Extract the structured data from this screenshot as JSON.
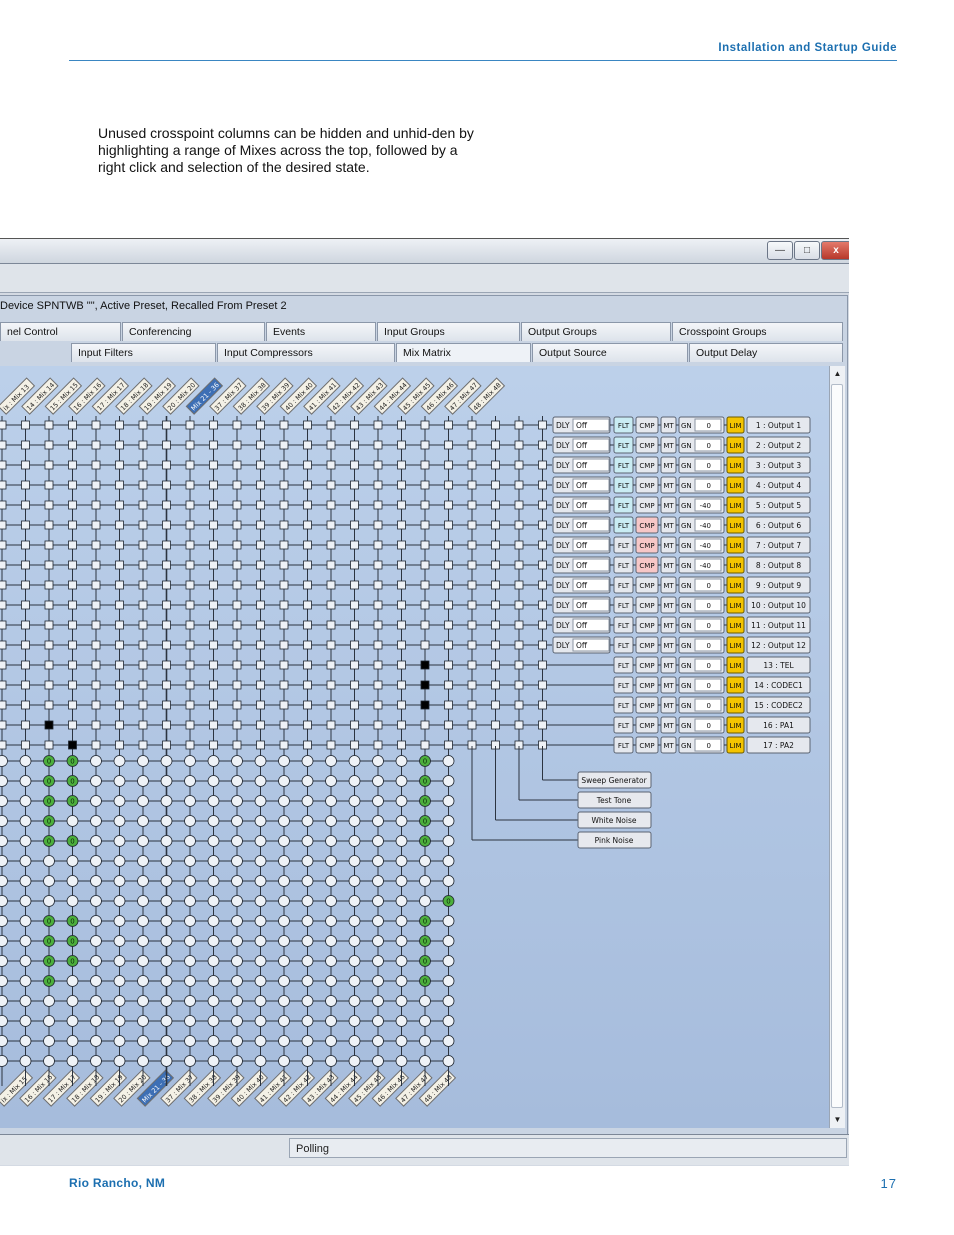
{
  "header": {
    "title": "Installation and Startup Guide"
  },
  "intro_text": "Unused crosspoint columns can be hidden and unhid-den by highlighting a range of Mixes across the top, followed by a right click and selection of the desired state.",
  "window": {
    "controls": {
      "minimize": "—",
      "maximize": "□",
      "close": "x"
    },
    "device_status": "Device SPNTWB \"\", Active Preset, Recalled From Preset 2",
    "tabs_row1": [
      "nel Control",
      "Conferencing",
      "Events",
      "Input Groups",
      "Output Groups",
      "Crosspoint Groups"
    ],
    "tabs_row2": [
      "Input Filters",
      "Input Compressors",
      "Mix Matrix",
      "Output Source",
      "Output Delay"
    ],
    "status_cell": "Polling"
  },
  "matrix": {
    "column_headers_top": [
      "ix : Mix 13",
      "14 : Mix 14",
      "15 : Mix 15",
      "16 : Mix 16",
      "17 : Mix 17",
      "18 : Mix 18",
      "19 : Mix 19",
      "20 : Mix 20",
      "Mix 21 - 36",
      "37 : Mix 37",
      "38 : Mix 38",
      "39 : Mix 39",
      "40 : Mix 40",
      "41 : Mix 41",
      "42 : Mix 42",
      "43 : Mix 43",
      "44 : Mix 44",
      "45 : Mix 45",
      "46 : Mix 46",
      "47 : Mix 47",
      "48 : Mix 48"
    ],
    "column_headers_bottom": [
      "ix : Mix 15",
      "16 : Mix 16",
      "17 : Mix 17",
      "18 : Mix 18",
      "19 : Mix 19",
      "20 : Mix 20",
      "Mix 21 - 36",
      "37 : Mix 37",
      "38 : Mix 38",
      "39 : Mix 39",
      "40 : Mix 40",
      "41 : Mix 41",
      "42 : Mix 42",
      "43 : Mix 43",
      "44 : Mix 44",
      "45 : Mix 45",
      "46 : Mix 46",
      "47 : Mix 47",
      "48 : Mix 48"
    ],
    "outputs": [
      {
        "delay": "DLY",
        "delay_value": "Off",
        "filter": "FLT",
        "comp": "CMP",
        "mute": "MT",
        "gain": "GN",
        "gain_value": "0",
        "limiter": "LIM",
        "label": "1 : Output 1"
      },
      {
        "delay": "DLY",
        "delay_value": "Off",
        "filter": "FLT",
        "comp": "CMP",
        "mute": "MT",
        "gain": "GN",
        "gain_value": "0",
        "limiter": "LIM",
        "label": "2 : Output 2"
      },
      {
        "delay": "DLY",
        "delay_value": "Off",
        "filter": "FLT",
        "comp": "CMP",
        "mute": "MT",
        "gain": "GN",
        "gain_value": "0",
        "limiter": "LIM",
        "label": "3 : Output 3"
      },
      {
        "delay": "DLY",
        "delay_value": "Off",
        "filter": "FLT",
        "comp": "CMP",
        "mute": "MT",
        "gain": "GN",
        "gain_value": "0",
        "limiter": "LIM",
        "label": "4 : Output 4"
      },
      {
        "delay": "DLY",
        "delay_value": "Off",
        "filter": "FLT",
        "comp": "CMP",
        "mute": "MT",
        "gain": "GN",
        "gain_value": "-40",
        "limiter": "LIM",
        "label": "5 : Output 5"
      },
      {
        "delay": "DLY",
        "delay_value": "Off",
        "filter": "FLT",
        "comp": "CMP",
        "mute": "MT",
        "gain": "GN",
        "gain_value": "-40",
        "limiter": "LIM",
        "label": "6 : Output 6"
      },
      {
        "delay": "DLY",
        "delay_value": "Off",
        "filter": "FLT",
        "comp": "CMP",
        "mute": "MT",
        "gain": "GN",
        "gain_value": "-40",
        "limiter": "LIM",
        "label": "7 : Output 7"
      },
      {
        "delay": "DLY",
        "delay_value": "Off",
        "filter": "FLT",
        "comp": "CMP",
        "mute": "MT",
        "gain": "GN",
        "gain_value": "-40",
        "limiter": "LIM",
        "label": "8 : Output 8"
      },
      {
        "delay": "DLY",
        "delay_value": "Off",
        "filter": "FLT",
        "comp": "CMP",
        "mute": "MT",
        "gain": "GN",
        "gain_value": "0",
        "limiter": "LIM",
        "label": "9 : Output 9"
      },
      {
        "delay": "DLY",
        "delay_value": "Off",
        "filter": "FLT",
        "comp": "CMP",
        "mute": "MT",
        "gain": "GN",
        "gain_value": "0",
        "limiter": "LIM",
        "label": "10 : Output 10"
      },
      {
        "delay": "DLY",
        "delay_value": "Off",
        "filter": "FLT",
        "comp": "CMP",
        "mute": "MT",
        "gain": "GN",
        "gain_value": "0",
        "limiter": "LIM",
        "label": "11 : Output 11"
      },
      {
        "delay": "DLY",
        "delay_value": "Off",
        "filter": "FLT",
        "comp": "CMP",
        "mute": "MT",
        "gain": "GN",
        "gain_value": "0",
        "limiter": "LIM",
        "label": "12 : Output 12"
      },
      {
        "delay": "",
        "delay_value": "",
        "filter": "FLT",
        "comp": "CMP",
        "mute": "MT",
        "gain": "GN",
        "gain_value": "0",
        "limiter": "LIM",
        "label": "13 : TEL"
      },
      {
        "delay": "",
        "delay_value": "",
        "filter": "FLT",
        "comp": "CMP",
        "mute": "MT",
        "gain": "GN",
        "gain_value": "0",
        "limiter": "LIM",
        "label": "14 : CODEC1"
      },
      {
        "delay": "",
        "delay_value": "",
        "filter": "FLT",
        "comp": "CMP",
        "mute": "MT",
        "gain": "GN",
        "gain_value": "0",
        "limiter": "LIM",
        "label": "15 : CODEC2"
      },
      {
        "delay": "",
        "delay_value": "",
        "filter": "FLT",
        "comp": "CMP",
        "mute": "MT",
        "gain": "GN",
        "gain_value": "0",
        "limiter": "LIM",
        "label": "16 : PA1"
      },
      {
        "delay": "",
        "delay_value": "",
        "filter": "FLT",
        "comp": "CMP",
        "mute": "MT",
        "gain": "GN",
        "gain_value": "0",
        "limiter": "LIM",
        "label": "17 : PA2"
      }
    ],
    "generators": [
      "Sweep Generator",
      "Test Tone",
      "White Noise",
      "Pink Noise"
    ],
    "crosspoint_on_symbol": "0",
    "colors": {
      "filter_active": "#c9ecf3",
      "comp_active": "#f7c7c7",
      "limiter": "#f4c400",
      "on_crosspoint": "#4caf3c",
      "engaged": "#000000"
    }
  },
  "footer": {
    "location": "Rio Rancho, NM",
    "page_number": "17"
  }
}
